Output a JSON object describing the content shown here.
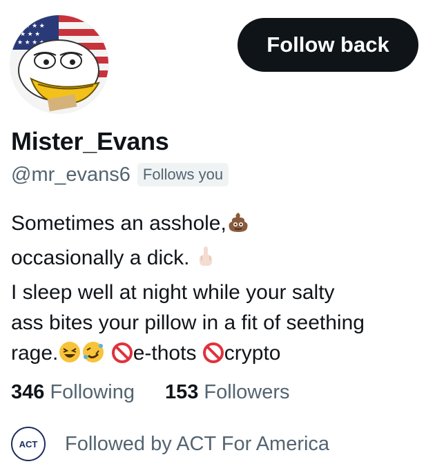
{
  "profile": {
    "display_name": "Mister_Evans",
    "handle": "@mr_evans6",
    "follows_you_badge": "Follows you",
    "follow_button_label": "Follow back",
    "avatar_icon": "cartoon-bird-with-flag-avatar"
  },
  "bio": {
    "line1": "Sometimes an asshole,",
    "line2": "occasionally a dick.",
    "line3": "I sleep well at night while your salty",
    "line4": "ass bites your pillow in a fit of seething",
    "line5_a": "rage.",
    "line5_b": "e-thots",
    "line5_c": "crypto",
    "emojis": [
      "pile-of-poo",
      "middle-finger",
      "grinning-squinting-face",
      "rolling-on-floor-laughing",
      "prohibited",
      "prohibited"
    ]
  },
  "stats": {
    "following_count": "346",
    "following_label": "Following",
    "followers_count": "153",
    "followers_label": "Followers"
  },
  "followed_by": {
    "text": "Followed by ACT For America",
    "avatar_text": "ACT"
  },
  "colors": {
    "text_primary": "#0f1419",
    "text_secondary": "#536471",
    "button_bg": "#0f1419",
    "badge_bg": "#eff3f4"
  }
}
